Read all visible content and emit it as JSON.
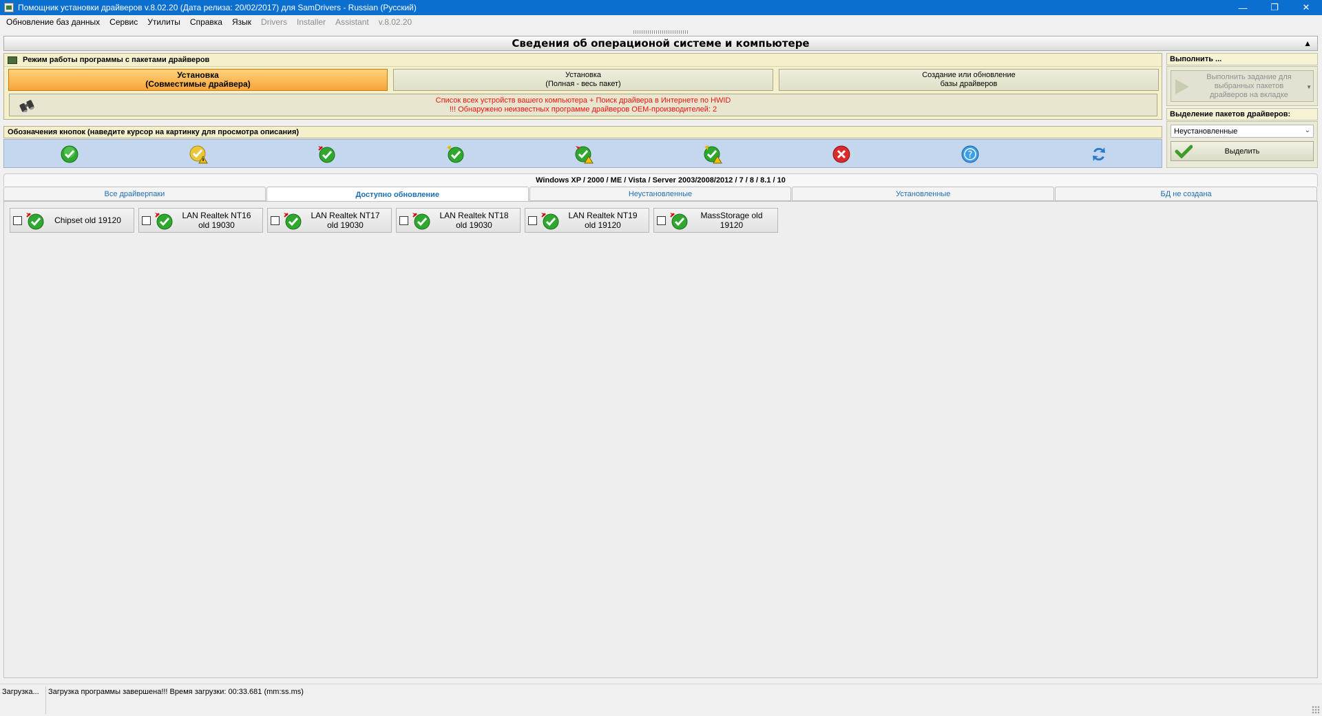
{
  "window": {
    "title": "Помощник установки драйверов v.8.02.20 (Дата релиза: 20/02/2017) для SamDrivers - Russian (Русский)",
    "controls": {
      "minimize": "—",
      "restore": "❐",
      "close": "✕"
    }
  },
  "menu": {
    "items": [
      "Обновление баз данных",
      "Сервис",
      "Утилиты",
      "Справка",
      "Язык"
    ],
    "dim_items": [
      "Drivers",
      "Installer",
      "Assistant",
      "v.8.02.20"
    ]
  },
  "sysinfo": {
    "title": "Сведения об операционой системе и компьютере",
    "collapse_glyph": "▲"
  },
  "mode_panel": {
    "title": "Режим работы программы с пакетами драйверов",
    "buttons": [
      {
        "line1": "Установка",
        "line2": "(Совместимые драйвера)"
      },
      {
        "line1": "Установка",
        "line2": "(Полная - весь пакет)"
      },
      {
        "line1": "Создание или обновление",
        "line2": "базы драйверов"
      }
    ],
    "hwid_line1": "Список всех устройств вашего компьютера + Поиск драйвера в Интернете по HWID",
    "hwid_line2": "!!! Обнаружено неизвестных программе драйверов OEM-производителей: 2"
  },
  "legend": {
    "title": "Обозначения кнопок (наведите курсор на картинку для просмотра описания)",
    "icons": [
      "green-check-icon",
      "yellow-warning-check-icon",
      "new-check-icon",
      "check-arrow-icon",
      "new-warning-check-icon",
      "warning-check-icon",
      "red-error-icon",
      "blue-question-icon",
      "blue-refresh-icon"
    ]
  },
  "right_panel": {
    "execute_title": "Выполнить ...",
    "execute_button": "Выполнить задание для выбранных пакетов драйверов на вкладке",
    "select_title": "Выделение пакетов драйверов:",
    "select_value": "Неустановленные",
    "select_button": "Выделить"
  },
  "tabs": {
    "os_title": "Windows XP / 2000 / ME / Vista / Server 2003/2008/2012 / 7 / 8 / 8.1 / 10",
    "items": [
      "Все драйверпаки",
      "Доступно обновление",
      "Неустановленные",
      "Установленные",
      "БД не создана"
    ],
    "active_index": 1
  },
  "driver_items": [
    {
      "label": "Chipset old 19120",
      "checked": false
    },
    {
      "label": "LAN Realtek NT16\nold 19030",
      "checked": false
    },
    {
      "label": "LAN Realtek NT17\nold 19030",
      "checked": false
    },
    {
      "label": "LAN Realtek NT18\nold 19030",
      "checked": false
    },
    {
      "label": "LAN Realtek NT19\nold 19120",
      "checked": false
    },
    {
      "label": "MassStorage old\n19120",
      "checked": false
    }
  ],
  "status": {
    "left": "Загрузка...",
    "message": "Загрузка программы завершена!!! Время загрузки: 00:33.681 (mm:ss.ms)"
  },
  "colors": {
    "titlebar": "#0b6fd0",
    "active_mode": "#f8a53a",
    "legend_bg": "#c5d7ee",
    "tab_text": "#1c6eb5",
    "hwid_text": "#e11111"
  }
}
